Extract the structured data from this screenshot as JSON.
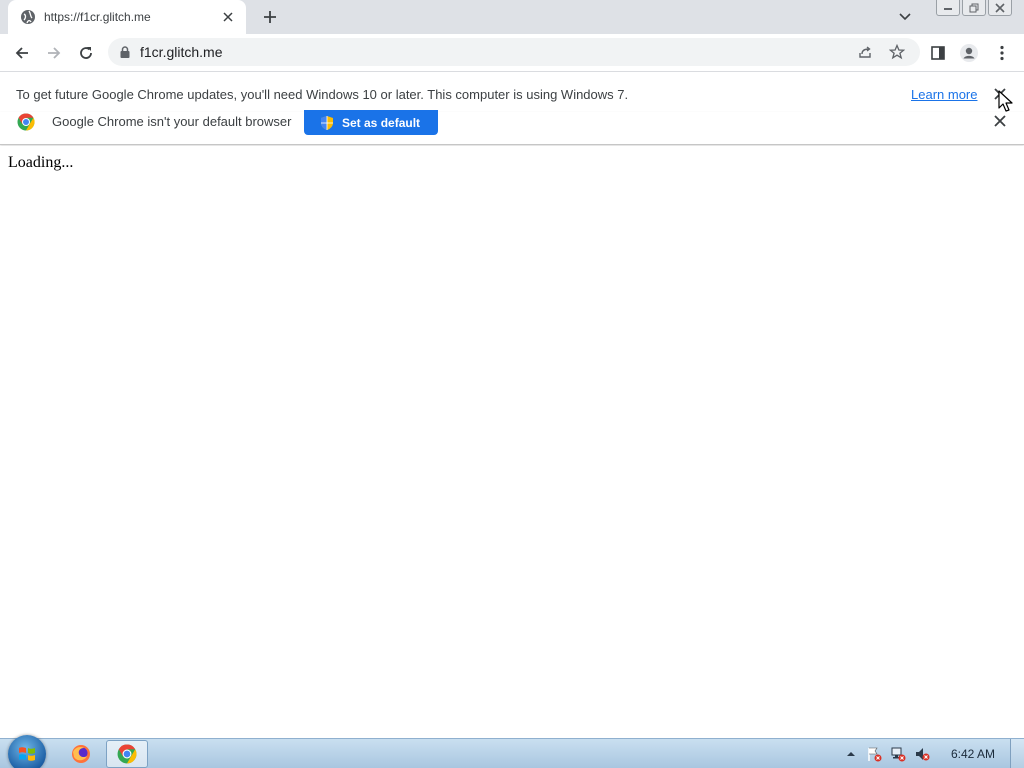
{
  "browser": {
    "tab": {
      "title": "https://f1cr.glitch.me"
    },
    "omnibox": {
      "url": "f1cr.glitch.me"
    }
  },
  "infobars": {
    "update_warning": {
      "message": "To get future Google Chrome updates, you'll need Windows 10 or later. This computer is using Windows 7.",
      "learn_more": "Learn more"
    },
    "default_browser": {
      "message": "Google Chrome isn't your default browser",
      "button_label": "Set as default"
    }
  },
  "page": {
    "text": "Loading..."
  },
  "taskbar": {
    "clock": "6:42 AM",
    "pinned": [
      "firefox-icon",
      "chrome-icon"
    ]
  },
  "colors": {
    "accent": "#1a73e8",
    "tabstrip": "#dee1e6",
    "omnibox": "#f1f3f4"
  }
}
